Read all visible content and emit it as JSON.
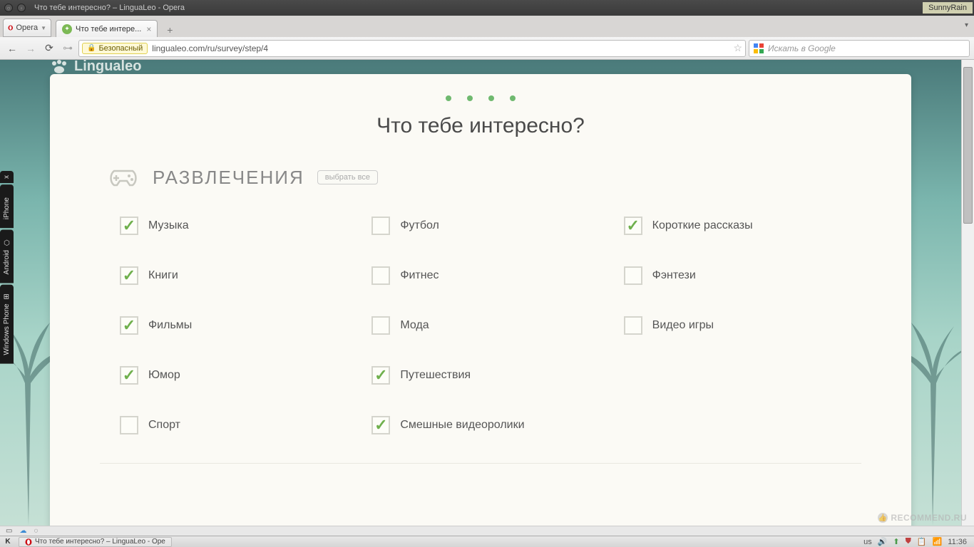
{
  "window": {
    "title": "Что тебе интересно? – LinguaLeo - Opera",
    "user_badge": "SunnyRain"
  },
  "tabstrip": {
    "opera_label": "Opera",
    "tab_title": "Что тебе интере..."
  },
  "addressbar": {
    "secure_label": "Безопасный",
    "url": "lingualeo.com/ru/survey/step/4",
    "search_placeholder": "Искать в Google"
  },
  "brand": "Lingualeo",
  "page": {
    "title": "Что тебе интересно?",
    "section_title": "РАЗВЛЕЧЕНИЯ",
    "select_all": "выбрать все"
  },
  "interests": [
    {
      "label": "Музыка",
      "checked": true
    },
    {
      "label": "Футбол",
      "checked": false
    },
    {
      "label": "Короткие рассказы",
      "checked": true
    },
    {
      "label": "Книги",
      "checked": true
    },
    {
      "label": "Фитнес",
      "checked": false
    },
    {
      "label": "Фэнтези",
      "checked": false
    },
    {
      "label": "Фильмы",
      "checked": true
    },
    {
      "label": "Мода",
      "checked": false
    },
    {
      "label": "Видео игры",
      "checked": false
    },
    {
      "label": "Юмор",
      "checked": true
    },
    {
      "label": "Путешествия",
      "checked": true
    },
    {
      "label": "",
      "checked": false,
      "empty": true
    },
    {
      "label": "Спорт",
      "checked": false
    },
    {
      "label": "Смешные видеоролики",
      "checked": true
    }
  ],
  "sidetabs": [
    "x",
    "iPhone",
    "Android",
    "Windows Phone"
  ],
  "watermark": "RECOMMEND.RU",
  "taskbar": {
    "active_task": "Что тебе интересно? – LinguaLeo - Ope",
    "lang": "us",
    "time": "11:36"
  }
}
